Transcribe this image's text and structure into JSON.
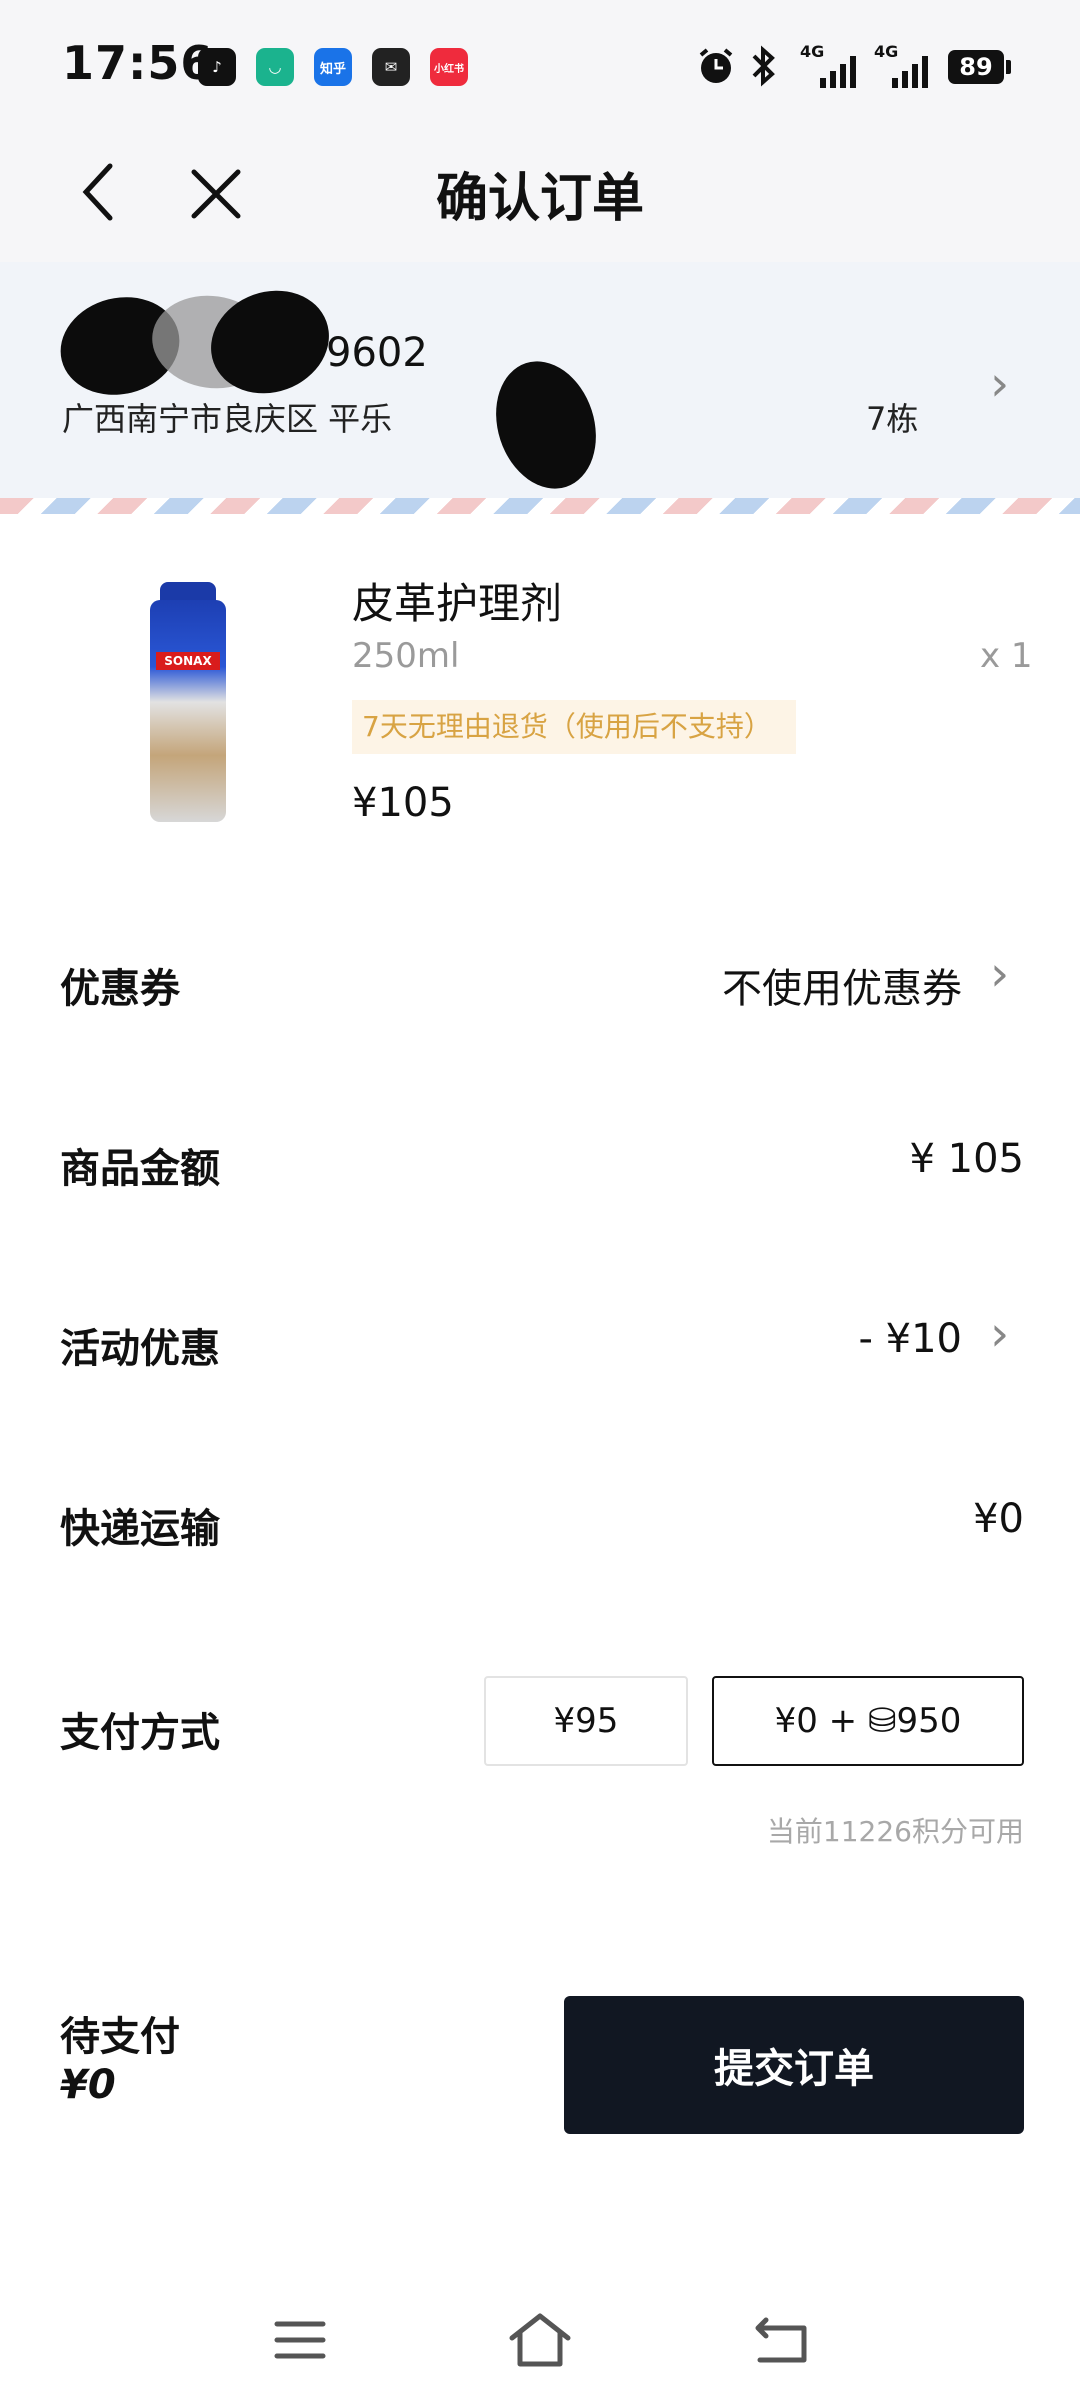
{
  "status_bar": {
    "time": "17:56",
    "notification_apps": [
      {
        "icon": "music-app-icon",
        "color": "#111111",
        "label": "♪"
      },
      {
        "icon": "mijia-app-icon",
        "color": "#1bb38e",
        "label": "◡"
      },
      {
        "icon": "zhihu-app-icon",
        "color": "#1a73e8",
        "label": "知乎"
      },
      {
        "icon": "mail-icon",
        "color": "#222222",
        "label": "✉"
      },
      {
        "icon": "xiaohongshu-app-icon",
        "color": "#ef2b3d",
        "label": "小红书"
      }
    ],
    "network_1": "4G",
    "network_2": "4G",
    "battery": "89"
  },
  "header": {
    "title": "确认订单",
    "back_icon": "back-arrow-icon",
    "close_icon": "close-icon"
  },
  "address": {
    "phone_suffix": "9602",
    "line_start": "广西南宁市良庆区  平乐",
    "line_end": "7栋"
  },
  "product": {
    "name": "皮革护理剂",
    "spec": "250ml",
    "quantity": "x 1",
    "tag": "7天无理由退货（使用后不支持）",
    "price": "¥105",
    "image_brand": "SONAX"
  },
  "rows": {
    "coupon": {
      "label": "优惠券",
      "value": "不使用优惠券"
    },
    "goods_amount": {
      "label": "商品金额",
      "value": "¥  105"
    },
    "promotion": {
      "label": "活动优惠",
      "value": "- ¥10"
    },
    "shipping": {
      "label": "快递运输",
      "value": "¥0"
    },
    "payment": {
      "label": "支付方式",
      "options": [
        {
          "label": "¥95",
          "selected": false
        },
        {
          "label": "¥0 + ⛁950",
          "selected": true
        }
      ],
      "points_note": "当前11226积分可用"
    }
  },
  "footer": {
    "due_label": "待支付",
    "due_amount": "¥0",
    "submit_label": "提交订单"
  }
}
